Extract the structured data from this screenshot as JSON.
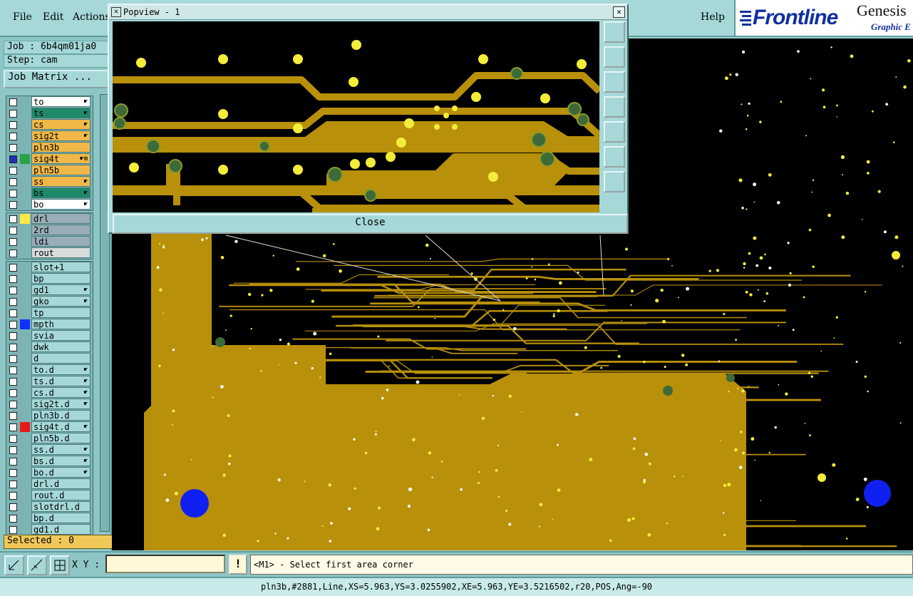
{
  "menubar": {
    "items": [
      {
        "label": "File"
      },
      {
        "label": "Edit"
      },
      {
        "label": "Actions"
      }
    ],
    "help": "Help"
  },
  "logo": {
    "brand": "Frontline",
    "product": "Genesis",
    "subtitle": "Graphic E"
  },
  "left_panel": {
    "job": "Job : 6b4qm01ja0",
    "step": "Step: cam",
    "job_matrix": "Job Matrix ...",
    "selected": "Selected : 0",
    "groups": [
      [
        {
          "name": "to",
          "bg": "#ffffff",
          "mark": "☛",
          "on": false,
          "ind": ""
        },
        {
          "name": "ts",
          "bg": "#1f8a6a",
          "mark": "☛",
          "on": false,
          "ind": ""
        },
        {
          "name": "cs",
          "bg": "#f0b848",
          "mark": "☛",
          "on": false,
          "ind": ""
        },
        {
          "name": "sig2t",
          "bg": "#f0b848",
          "mark": "☛",
          "on": false,
          "ind": ""
        },
        {
          "name": "pln3b",
          "bg": "#f0b848",
          "mark": "",
          "on": false,
          "ind": ""
        },
        {
          "name": "sig4t",
          "bg": "#f0b848",
          "mark": "☛⊞",
          "on": true,
          "ind": "#2aa04a"
        },
        {
          "name": "pln5b",
          "bg": "#f0b848",
          "mark": "",
          "on": false,
          "ind": ""
        },
        {
          "name": "ss",
          "bg": "#f0b848",
          "mark": "☛",
          "on": false,
          "ind": ""
        },
        {
          "name": "bs",
          "bg": "#1f8a6a",
          "mark": "☛",
          "on": false,
          "ind": ""
        },
        {
          "name": "bo",
          "bg": "#ffffff",
          "mark": "☛",
          "on": false,
          "ind": ""
        }
      ],
      [
        {
          "name": "drl",
          "bg": "#9aaeb8",
          "mark": "",
          "on": false,
          "ind": "#ffe84a"
        },
        {
          "name": "2rd",
          "bg": "#9aaeb8",
          "mark": "",
          "on": false,
          "ind": ""
        },
        {
          "name": "ldi",
          "bg": "#9aaeb8",
          "mark": "",
          "on": false,
          "ind": ""
        },
        {
          "name": "rout",
          "bg": "#d8dcdc",
          "mark": "",
          "on": false,
          "ind": ""
        }
      ],
      [
        {
          "name": "slot+1",
          "bg": "#a6d8d8",
          "mark": "",
          "on": false,
          "ind": ""
        },
        {
          "name": "bp",
          "bg": "#a6d8d8",
          "mark": "",
          "on": false,
          "ind": ""
        },
        {
          "name": "gd1",
          "bg": "#a6d8d8",
          "mark": "☛",
          "on": false,
          "ind": ""
        },
        {
          "name": "gko",
          "bg": "#a6d8d8",
          "mark": "☛",
          "on": false,
          "ind": ""
        },
        {
          "name": "tp",
          "bg": "#a6d8d8",
          "mark": "",
          "on": false,
          "ind": ""
        },
        {
          "name": "mpth",
          "bg": "#a6d8d8",
          "mark": "",
          "on": false,
          "ind": "#1030ff"
        },
        {
          "name": "svia",
          "bg": "#a6d8d8",
          "mark": "",
          "on": false,
          "ind": ""
        },
        {
          "name": "dwk",
          "bg": "#a6d8d8",
          "mark": "",
          "on": false,
          "ind": ""
        },
        {
          "name": "d",
          "bg": "#a6d8d8",
          "mark": "",
          "on": false,
          "ind": ""
        },
        {
          "name": "to.d",
          "bg": "#a6d8d8",
          "mark": "☛",
          "on": false,
          "ind": ""
        },
        {
          "name": "ts.d",
          "bg": "#a6d8d8",
          "mark": "☛",
          "on": false,
          "ind": ""
        },
        {
          "name": "cs.d",
          "bg": "#a6d8d8",
          "mark": "☛",
          "on": false,
          "ind": ""
        },
        {
          "name": "sig2t.d",
          "bg": "#a6d8d8",
          "mark": "☛",
          "on": false,
          "ind": ""
        },
        {
          "name": "pln3b.d",
          "bg": "#a6d8d8",
          "mark": "",
          "on": false,
          "ind": ""
        },
        {
          "name": "sig4t.d",
          "bg": "#a6d8d8",
          "mark": "☛",
          "on": false,
          "ind": "#e81818"
        },
        {
          "name": "pln5b.d",
          "bg": "#a6d8d8",
          "mark": "",
          "on": false,
          "ind": ""
        },
        {
          "name": "ss.d",
          "bg": "#a6d8d8",
          "mark": "☛",
          "on": false,
          "ind": ""
        },
        {
          "name": "bs.d",
          "bg": "#a6d8d8",
          "mark": "☛",
          "on": false,
          "ind": ""
        },
        {
          "name": "bo.d",
          "bg": "#a6d8d8",
          "mark": "☛",
          "on": false,
          "ind": ""
        },
        {
          "name": "drl.d",
          "bg": "#a6d8d8",
          "mark": "",
          "on": false,
          "ind": ""
        },
        {
          "name": "rout.d",
          "bg": "#a6d8d8",
          "mark": "",
          "on": false,
          "ind": ""
        },
        {
          "name": "slotdrl.d",
          "bg": "#a6d8d8",
          "mark": "",
          "on": false,
          "ind": ""
        },
        {
          "name": "bp.d",
          "bg": "#a6d8d8",
          "mark": "",
          "on": false,
          "ind": ""
        },
        {
          "name": "gd1.d",
          "bg": "#a6d8d8",
          "mark": "",
          "on": false,
          "ind": ""
        }
      ]
    ]
  },
  "popview": {
    "title": "Popview - 1",
    "close": "Close"
  },
  "bottom": {
    "xy_label": "X Y :",
    "xy_value": "",
    "excl": "!",
    "prompt": "<M1> - Select first area corner"
  },
  "status": "pln3b,#2881,Line,XS=5.963,YS=3.0255902,XE=5.963,YE=3.5216502,r20,POS,Ang=-90",
  "colors": {
    "copper": "#b8900a",
    "pad": "#f4ec3a",
    "via": "#3e6a3a",
    "blue_pad": "#1020f0",
    "background": "#000000"
  }
}
